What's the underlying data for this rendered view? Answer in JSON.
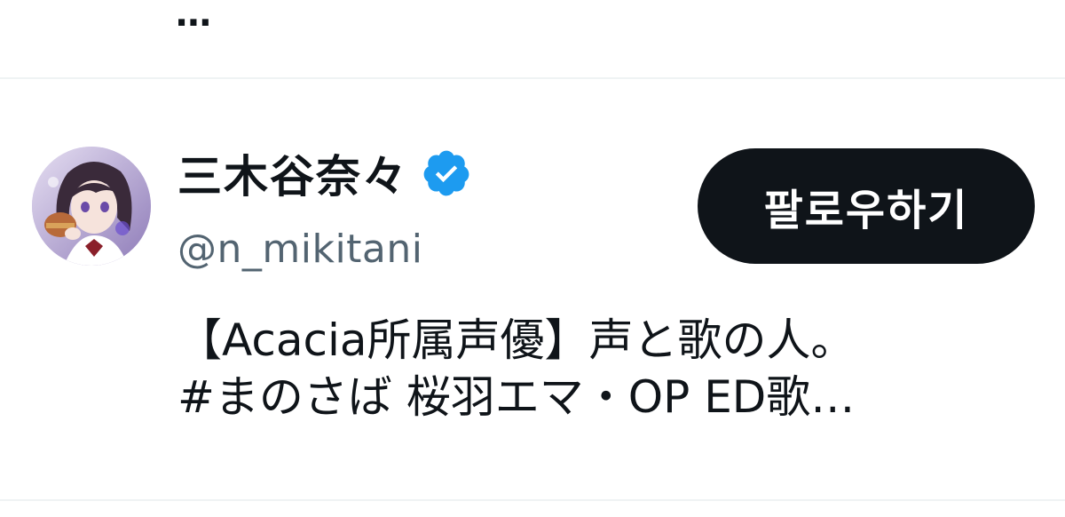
{
  "header": {
    "more_label": "⋯"
  },
  "user": {
    "display_name": "三木谷奈々",
    "verified": true,
    "verified_icon": "verified-badge-icon",
    "handle": "@n_mikitani",
    "avatar": "avatar-image"
  },
  "actions": {
    "follow_label": "팔로우하기"
  },
  "bio": {
    "line1": "【Acacia所属声優】声と歌の人。",
    "line2": "#まのさば 桜羽エマ・OP ED歌…"
  },
  "colors": {
    "text_primary": "#0f1419",
    "text_secondary": "#536471",
    "verified_blue": "#1d9bf0",
    "button_bg": "#0f1419",
    "divider": "#eff3f4"
  }
}
